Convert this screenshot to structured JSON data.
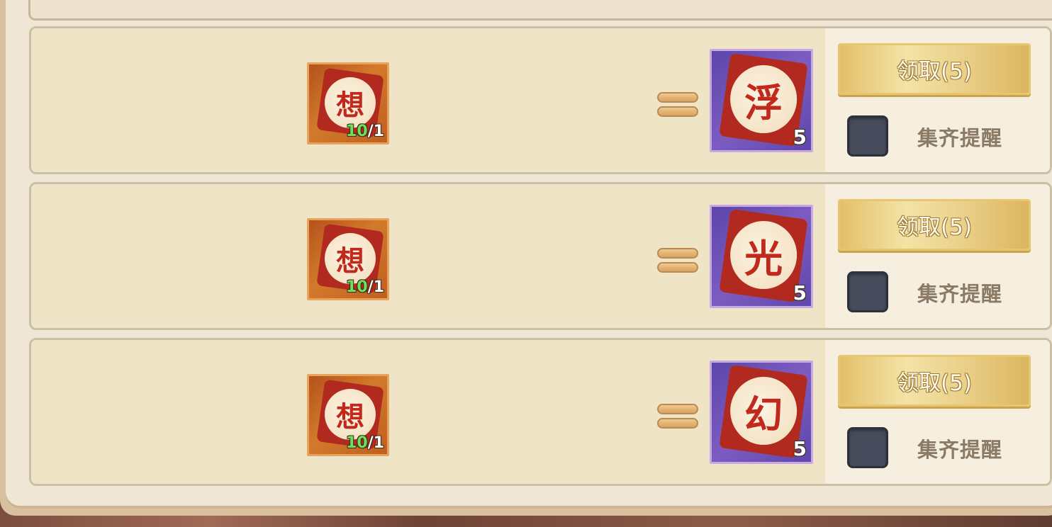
{
  "rows": [
    {
      "cost_item": {
        "glyph": "想",
        "have": "10",
        "need": "/1"
      },
      "reward_item": {
        "glyph": "浮",
        "quantity": "5"
      },
      "claim_label": "领取(5)",
      "remind_label": "集齐提醒"
    },
    {
      "cost_item": {
        "glyph": "想",
        "have": "10",
        "need": "/1"
      },
      "reward_item": {
        "glyph": "光",
        "quantity": "5"
      },
      "claim_label": "领取(5)",
      "remind_label": "集齐提醒"
    },
    {
      "cost_item": {
        "glyph": "想",
        "have": "10",
        "need": "/1"
      },
      "reward_item": {
        "glyph": "幻",
        "quantity": "5"
      },
      "claim_label": "领取(5)",
      "remind_label": "集齐提醒"
    }
  ],
  "icons": {
    "equals": "equals-icon",
    "checkbox": "checkbox-unchecked"
  },
  "colors": {
    "panel_bg": "#efe4c6",
    "claim_button": "#f4e3a6",
    "have_count": "#6ee05a",
    "checkbox": "#454b5a"
  }
}
